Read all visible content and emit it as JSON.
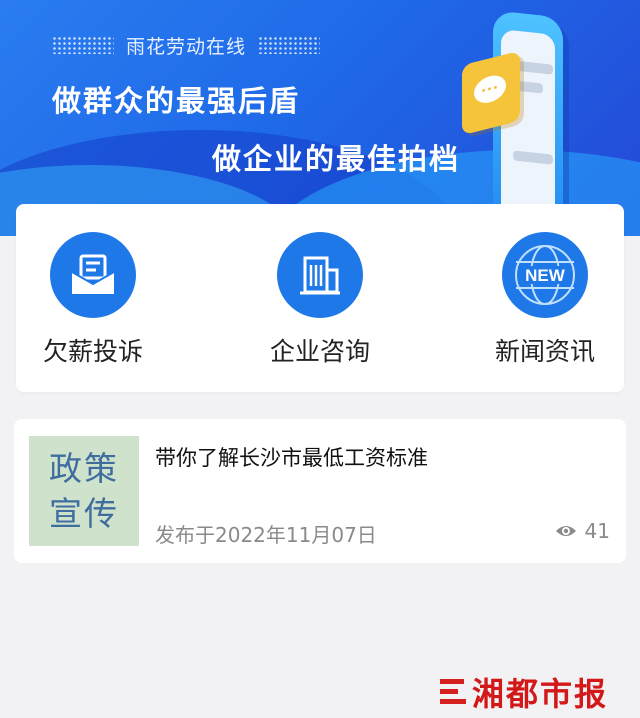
{
  "banner": {
    "brand": "雨花劳动在线",
    "slogan_line1": "做群众的最强后盾",
    "slogan_line2": "做企业的最佳拍档",
    "bubble_text": "···"
  },
  "quick_actions": [
    {
      "label": "欠薪投诉",
      "icon": "envelope-icon"
    },
    {
      "label": "企业咨询",
      "icon": "building-icon"
    },
    {
      "label": "新闻资讯",
      "icon": "globe-new-icon",
      "icon_text": "NEW"
    }
  ],
  "news": {
    "thumb_line1": "政策",
    "thumb_line2": "宣传",
    "title": "带你了解长沙市最低工资标准",
    "date": "发布于2022年11月07日",
    "views": "41"
  },
  "watermark": "湘都市报",
  "colors": {
    "primary": "#1f78e8",
    "thumb_bg": "#cfe3cc",
    "watermark": "#d21818"
  }
}
